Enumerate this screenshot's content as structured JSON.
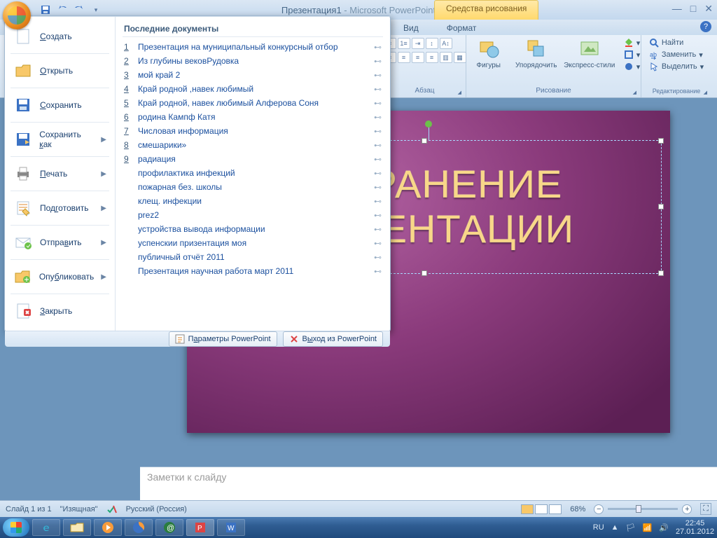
{
  "title": {
    "doc": "Презентация1",
    "app": "Microsoft PowerPoint"
  },
  "tools_tab": "Средства рисования",
  "tabs": {
    "view": "Вид",
    "format": "Формат"
  },
  "ribbon": {
    "paragraph": "Абзац",
    "drawing": "Рисование",
    "editing": "Редактирование",
    "shapes": "Фигуры",
    "arrange": "Упорядочить",
    "styles": "Экспресс-стили",
    "find": "Найти",
    "replace": "Заменить",
    "select": "Выделить"
  },
  "menu": {
    "recent_header": "Последние документы",
    "items": {
      "new": "Создать",
      "open": "Открыть",
      "save": "Сохранить",
      "saveas": "Сохранить как",
      "print": "Печать",
      "prepare": "Подготовить",
      "send": "Отправить",
      "publish": "Опубликовать",
      "close": "Закрыть"
    },
    "recent": [
      {
        "n": "1",
        "t": "Презентация на муниципальный конкурсный отбор"
      },
      {
        "n": "2",
        "t": "Из глубины вековРудовка"
      },
      {
        "n": "3",
        "t": "мой  край 2"
      },
      {
        "n": "4",
        "t": "Край родной ,навек любимый"
      },
      {
        "n": "5",
        "t": "Край родной, навек любимый Алферова Соня"
      },
      {
        "n": "6",
        "t": "родина Кампф Катя"
      },
      {
        "n": "7",
        "t": "Числовая информация"
      },
      {
        "n": "8",
        "t": "смешарики»"
      },
      {
        "n": "9",
        "t": "радиация"
      },
      {
        "n": "",
        "t": "профилактика инфекций"
      },
      {
        "n": "",
        "t": "пожарная без. школы"
      },
      {
        "n": "",
        "t": "клещ. инфекции"
      },
      {
        "n": "",
        "t": "prez2"
      },
      {
        "n": "",
        "t": "устройства вывода информации"
      },
      {
        "n": "",
        "t": "успенскии  призентация моя"
      },
      {
        "n": "",
        "t": "публичный отчёт 2011"
      },
      {
        "n": "",
        "t": "Презентация научная работа март 2011"
      }
    ],
    "options": "Параметры PowerPoint",
    "exit": "Выход из PowerPoint"
  },
  "slide": {
    "title": "СОХРАНЕНИЕ ПРЕЗЕНТАЦИИ"
  },
  "notes_placeholder": "Заметки к слайду",
  "status": {
    "slide": "Слайд 1 из 1",
    "theme": "\"Изящная\"",
    "lang": "Русский (Россия)",
    "zoom": "68%"
  },
  "tray": {
    "lang": "RU",
    "time": "22:45",
    "date": "27.01.2012"
  }
}
